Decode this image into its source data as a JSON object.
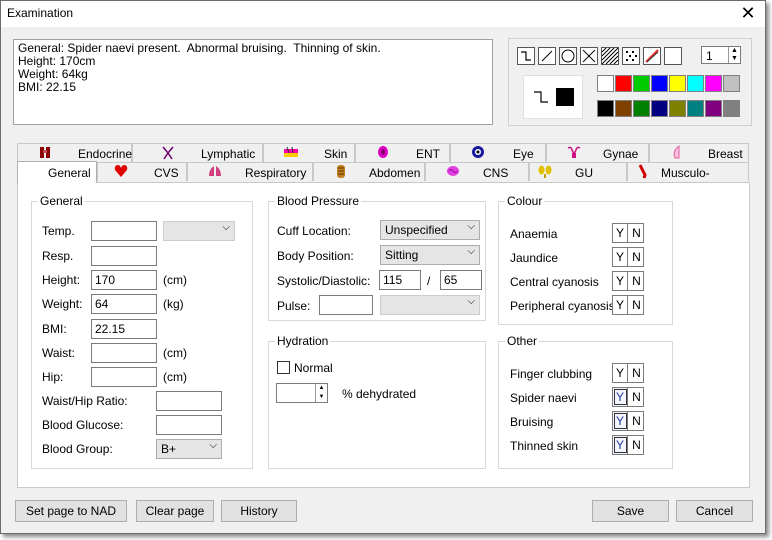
{
  "window": {
    "title": "Examination",
    "close": "✕"
  },
  "notes": {
    "lines": [
      "General: Spider naevi present.  Abnormal bruising.  Thinning of skin.",
      "Height: 170cm",
      "Weight: 64kg",
      "BMI: 22.15"
    ]
  },
  "drawing": {
    "pen_width": "1",
    "colors": [
      "#ffffff",
      "#ff0000",
      "#00cc00",
      "#0000ff",
      "#ffff00",
      "#00ffff",
      "#ff00ff",
      "#c0c0c0",
      "#000000",
      "#804000",
      "#008000",
      "#000080",
      "#808000",
      "#008080",
      "#800080",
      "#808080"
    ],
    "tool_icons": [
      "curve-tool-icon",
      "line-tool-icon",
      "circle-tool-icon",
      "cross-tool-icon",
      "hatch-tool-icon",
      "dots-tool-icon",
      "eraser-tool-icon",
      "blank-tool-icon"
    ]
  },
  "tabs": {
    "back": [
      {
        "label": "Endocrine",
        "icon": "endocrine-icon"
      },
      {
        "label": "Lymphatic",
        "icon": "lymphatic-icon"
      },
      {
        "label": "Skin",
        "icon": "skin-icon"
      },
      {
        "label": "ENT",
        "icon": "ent-icon"
      },
      {
        "label": "Eye",
        "icon": "eye-icon"
      },
      {
        "label": "Gynae",
        "icon": "gynae-icon"
      },
      {
        "label": "Breast",
        "icon": "breast-icon"
      }
    ],
    "front": [
      {
        "label": "General",
        "icon": ""
      },
      {
        "label": "CVS",
        "icon": "heart-icon"
      },
      {
        "label": "Respiratory",
        "icon": "lungs-icon"
      },
      {
        "label": "Abdomen",
        "icon": "abdomen-icon"
      },
      {
        "label": "CNS",
        "icon": "brain-icon"
      },
      {
        "label": "GU",
        "icon": "kidneys-icon"
      },
      {
        "label": "Musculo-skeletal",
        "icon": "bone-icon"
      }
    ]
  },
  "general": {
    "title": "General",
    "temp_label": "Temp.",
    "temp_value": "",
    "resp_label": "Resp.",
    "resp_value": "",
    "height_label": "Height:",
    "height_value": "170",
    "height_unit": "(cm)",
    "weight_label": "Weight:",
    "weight_value": "64",
    "weight_unit": "(kg)",
    "bmi_label": "BMI:",
    "bmi_value": "22.15",
    "waist_label": "Waist:",
    "waist_value": "",
    "waist_unit": "(cm)",
    "hip_label": "Hip:",
    "hip_value": "",
    "hip_unit": "(cm)",
    "ratio_label": "Waist/Hip Ratio:",
    "ratio_value": "",
    "glucose_label": "Blood Glucose:",
    "glucose_value": "",
    "group_label": "Blood Group:",
    "group_value": "B+"
  },
  "bp": {
    "title": "Blood Pressure",
    "cuff_label": "Cuff Location:",
    "cuff_value": "Unspecified",
    "position_label": "Body Position:",
    "position_value": "Sitting",
    "sysdia_label": "Systolic/Diastolic:",
    "systolic": "115",
    "slash": "/",
    "diastolic": "65",
    "pulse_label": "Pulse:",
    "pulse_value": ""
  },
  "hydration": {
    "title": "Hydration",
    "normal_label": "Normal",
    "dehydrated_label": "% dehydrated"
  },
  "colour": {
    "title": "Colour",
    "items": [
      {
        "label": "Anaemia",
        "yes": false
      },
      {
        "label": "Jaundice",
        "yes": false
      },
      {
        "label": "Central cyanosis",
        "yes": false
      },
      {
        "label": "Peripheral cyanosis",
        "yes": false
      }
    ]
  },
  "other": {
    "title": "Other",
    "items": [
      {
        "label": "Finger clubbing",
        "yes": false
      },
      {
        "label": "Spider naevi",
        "yes": true
      },
      {
        "label": "Bruising",
        "yes": true
      },
      {
        "label": "Thinned skin",
        "yes": true
      }
    ]
  },
  "yn": {
    "y": "Y",
    "n": "N"
  },
  "buttons": {
    "nad": "Set page to NAD",
    "clear": "Clear page",
    "history": "History",
    "save": "Save",
    "cancel": "Cancel"
  }
}
